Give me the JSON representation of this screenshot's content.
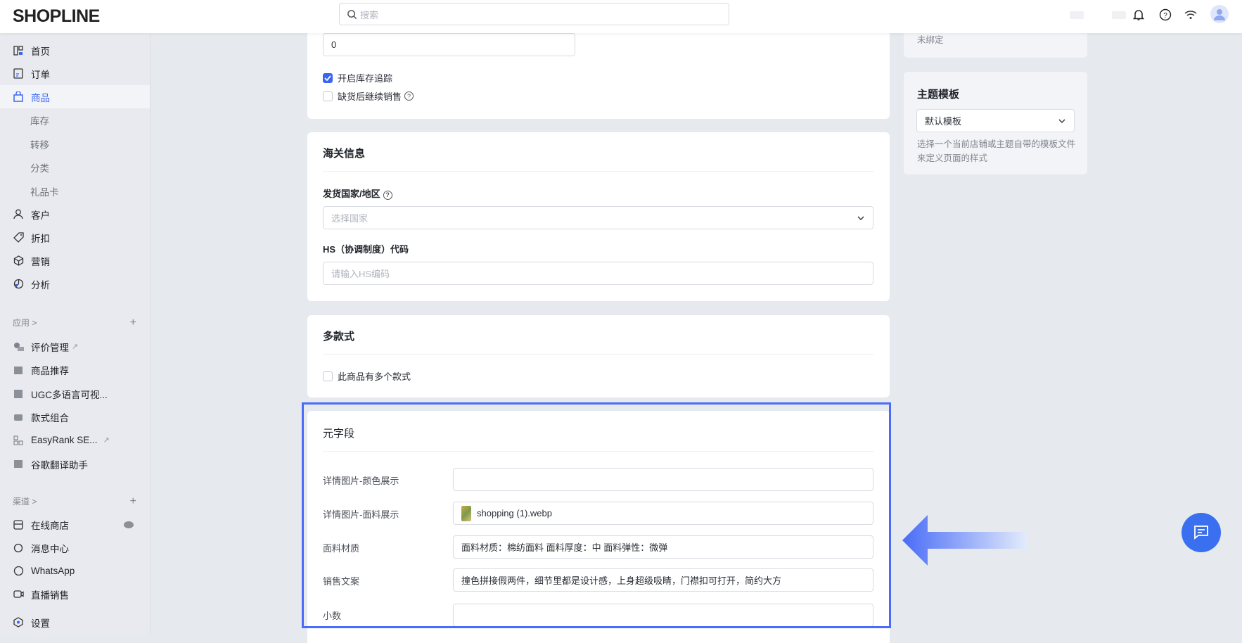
{
  "header": {
    "logo": "SHOPLINE",
    "search_placeholder": "搜索"
  },
  "sidebar": {
    "main": [
      {
        "label": "首页",
        "icon": "home-icon"
      },
      {
        "label": "订单",
        "icon": "order-icon"
      },
      {
        "label": "商品",
        "icon": "bag-icon",
        "active": true
      }
    ],
    "product_sub": [
      "库存",
      "转移",
      "分类",
      "礼品卡"
    ],
    "main2": [
      {
        "label": "客户",
        "icon": "user-icon"
      },
      {
        "label": "折扣",
        "icon": "tag-icon"
      },
      {
        "label": "营销",
        "icon": "cube-icon"
      },
      {
        "label": "分析",
        "icon": "chart-icon"
      }
    ],
    "apps_label": "应用 >",
    "apps": [
      "评价管理",
      "商品推荐",
      "UGC多语言可视...",
      "款式组合",
      "EasyRank SE...",
      "谷歌翻译助手"
    ],
    "channels_label": "渠道 >",
    "channels": [
      "在线商店",
      "消息中心",
      "WhatsApp",
      "直播销售"
    ],
    "settings": "设置"
  },
  "inventory": {
    "quantity": "0",
    "track_label": "开启库存追踪",
    "track_checked": true,
    "oversell_label": "缺货后继续销售",
    "oversell_checked": false
  },
  "customs": {
    "title": "海关信息",
    "country_label": "发货国家/地区",
    "country_placeholder": "选择国家",
    "hs_label": "HS（协调制度）代码",
    "hs_placeholder": "请输入HS编码"
  },
  "variants": {
    "title": "多款式",
    "checkbox_label": "此商品有多个款式",
    "checked": false
  },
  "metafields": {
    "title": "元字段",
    "rows": [
      {
        "label": "详情图片-颜色展示",
        "value": ""
      },
      {
        "label": "详情图片-面料展示",
        "value": "shopping (1).webp"
      },
      {
        "label": "面料材质",
        "value": "面料材质：棉纺面料 面料厚度：中 面料弹性：微弹"
      },
      {
        "label": "销售文案",
        "value": "撞色拼接假两件，细节里都是设计感，上身超级吸睛，门襟扣可打开，简约大方"
      },
      {
        "label": "小数",
        "value": ""
      }
    ]
  },
  "right": {
    "binding_status": "未绑定",
    "template_title": "主题模板",
    "template_value": "默认模板",
    "template_help": "选择一个当前店铺或主题自带的模板文件来定义页面的样式"
  },
  "colors": {
    "accent": "#3a66f5",
    "highlight": "#4a6cf7"
  }
}
